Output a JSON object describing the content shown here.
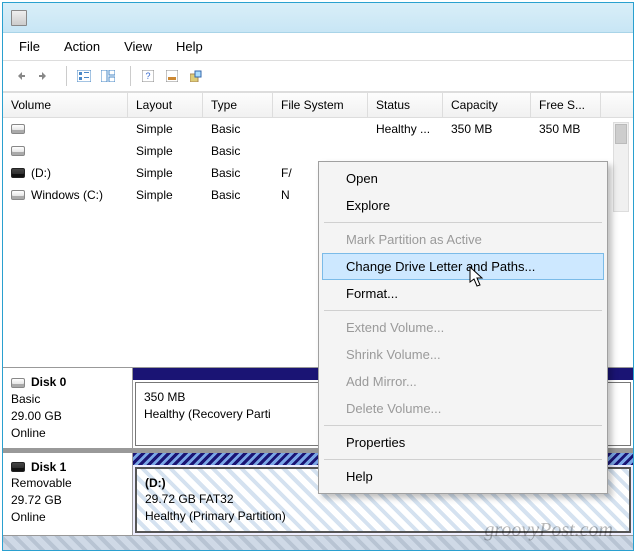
{
  "menu": {
    "file": "File",
    "action": "Action",
    "view": "View",
    "help": "Help"
  },
  "columns": {
    "volume": "Volume",
    "layout": "Layout",
    "type": "Type",
    "filesystem": "File System",
    "status": "Status",
    "capacity": "Capacity",
    "free": "Free S..."
  },
  "rows": [
    {
      "label": "",
      "layout": "Simple",
      "type": "Basic",
      "fs": "",
      "status": "Healthy ...",
      "cap": "350 MB",
      "free": "350 MB"
    },
    {
      "label": "",
      "layout": "Simple",
      "type": "Basic",
      "fs": "",
      "status": "",
      "cap": "",
      "free": ""
    },
    {
      "label": "(D:)",
      "layout": "Simple",
      "type": "Basic",
      "fs": "F/",
      "status": "",
      "cap": "",
      "free": ""
    },
    {
      "label": "Windows (C:)",
      "layout": "Simple",
      "type": "Basic",
      "fs": "N",
      "status": "",
      "cap": "",
      "free": ""
    }
  ],
  "disks": [
    {
      "name": "Disk 0",
      "type": "Basic",
      "size": "29.00 GB",
      "status": "Online",
      "partition": {
        "line1": "",
        "line2": "350 MB",
        "line3": "Healthy (Recovery Parti"
      }
    },
    {
      "name": "Disk 1",
      "type": "Removable",
      "size": "29.72 GB",
      "status": "Online",
      "partition": {
        "line1": "(D:)",
        "line2": "29.72 GB FAT32",
        "line3": "Healthy (Primary Partition)"
      }
    }
  ],
  "contextMenu": {
    "open": "Open",
    "explore": "Explore",
    "markActive": "Mark Partition as Active",
    "changeLetter": "Change Drive Letter and Paths...",
    "format": "Format...",
    "extend": "Extend Volume...",
    "shrink": "Shrink Volume...",
    "addMirror": "Add Mirror...",
    "delete": "Delete Volume...",
    "properties": "Properties",
    "help": "Help"
  },
  "watermark": "groovyPost.com"
}
